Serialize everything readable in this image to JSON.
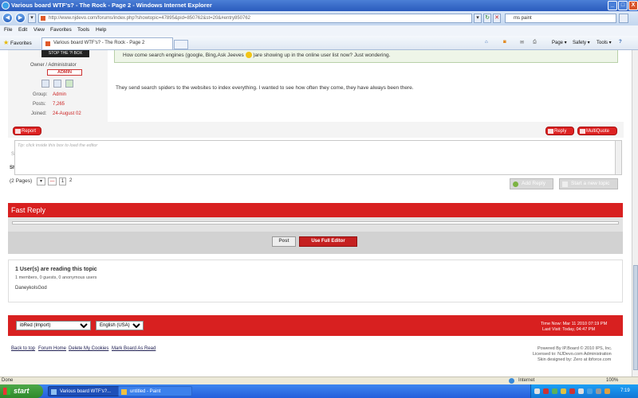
{
  "window": {
    "title": "Various board WTF's? - The Rock - Page 2 - Windows Internet Explorer",
    "min": "_",
    "max": "□",
    "close": "X"
  },
  "address": {
    "url": "http://www.njdevo.com/forums/index.php?showtopic=47895&pid=850762&st=20&#entry850762",
    "search_value": "ms paint"
  },
  "menu": [
    "File",
    "Edit",
    "View",
    "Favorites",
    "Tools",
    "Help"
  ],
  "tabs": {
    "favorites": "Favorites",
    "active": "Various board WTF's? - The Rock - Page 2"
  },
  "toolbar": {
    "page": "Page ▾",
    "safety": "Safety ▾",
    "tools": "Tools ▾",
    "help": "?"
  },
  "post": {
    "banner": "STOP THE ?! BOX",
    "rank": "Owner / Administrator",
    "badge": "ADMIN",
    "group_label": "Group:",
    "group_value": "Admin",
    "posts_label": "Posts:",
    "posts_value": "7,265",
    "joined_label": "Joined:",
    "joined_value": "24-August 02",
    "quote": "How come search engines (google, Bing,Ask Jeeves",
    "quote_end": ")are showing up in the online user list now? Just wondering.",
    "body": "They send search spiders to the websites to index everything. I wanted to see how often they come, they have always been there.",
    "report": "Report",
    "reply": "Reply",
    "multiquote": "MultiQuote"
  },
  "reply_box": {
    "placeholder": "Tip: click inside this box to load the editor"
  },
  "pagination": {
    "pages": "(2 Pages)",
    "current": "1",
    "next": "2",
    "side_s1": "S",
    "side_s2": "Sh"
  },
  "buttons": {
    "add_reply": "Add Reply",
    "new_topic": "Start a new topic"
  },
  "fast_reply": {
    "title": "Fast Reply",
    "post": "Post",
    "full_editor": "Use Full Editor"
  },
  "users": {
    "title": "1 User(s) are reading this topic",
    "subtitle": "1 members, 0 guests, 0 anonymous users",
    "name": "DaneykoIsGod"
  },
  "footer": {
    "skin": "ibRed (Import)",
    "language": "English (USA)",
    "time_now": "Time Now: Mar 11 2010 07:19 PM",
    "last_visit": "Last Visit: Today, 04:47 PM"
  },
  "links": {
    "back_to_top": "Back to top",
    "forum_home": "Forum Home",
    "delete_cookies": "Delete My Cookies",
    "mark_read": "Mark Board As Read",
    "powered": "Powered By IP.Board © 2010  IPS, Inc.",
    "licensed": "Licensed to: NJDevo.com Administration",
    "skin_designer": "Skin designed by: Zero at ibforce.com"
  },
  "status": {
    "done": "Done",
    "zone": "Internet",
    "zoom": "100%"
  },
  "taskbar": {
    "start": "start",
    "task1": "Various board WTF's?...",
    "task2": "untitled - Paint",
    "clock": "7:19 PM"
  },
  "colors": {
    "forum_red": "#d82020",
    "xp_blue": "#245edb",
    "start_green": "#3a9a35"
  }
}
